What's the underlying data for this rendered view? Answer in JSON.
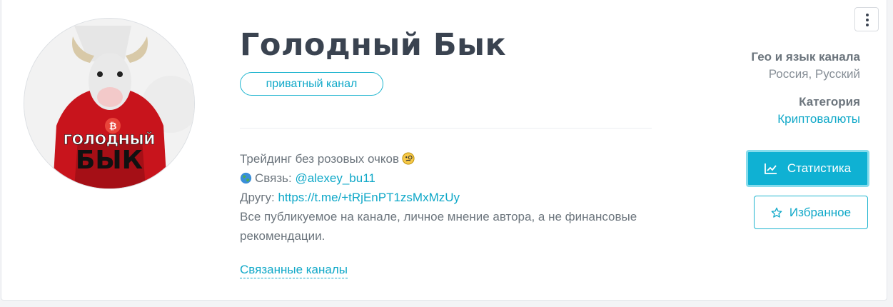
{
  "channel": {
    "name": "Голодный Бык",
    "badge": "приватный канал",
    "avatar_text_top": "ГОЛОДНЫЙ",
    "avatar_text_bottom": "БЫК",
    "description": {
      "line1": "Трейдинг без розовых очков",
      "line1_emoji_icon": "monocle-face-icon",
      "line2_icon": "globe-icon",
      "line2_label": "Связь:",
      "line2_link": "@alexey_bu11",
      "line3_label": "Другу:",
      "line3_link": "https://t.me/+tRjEnPT1zsMxMzUy",
      "line4": "Все публикуемое на канале, личное мнение автора, а не финансовые",
      "line5": "рекомендации."
    },
    "related_link": "Связанные каналы"
  },
  "sidebar": {
    "geo_heading": "Гео и язык канала",
    "geo_value": "Россия, Русский",
    "category_heading": "Категория",
    "category_value": "Криптовалюты",
    "stats_button": "Статистика",
    "stats_icon": "line-chart-icon",
    "favorite_button": "Избранное",
    "favorite_icon": "star-icon",
    "menu_icon": "kebab-menu-icon"
  },
  "colors": {
    "accent": "#0fa8c8",
    "button_fill": "#0fb1d3",
    "title": "#3a4350",
    "text_muted": "#6c757d"
  }
}
